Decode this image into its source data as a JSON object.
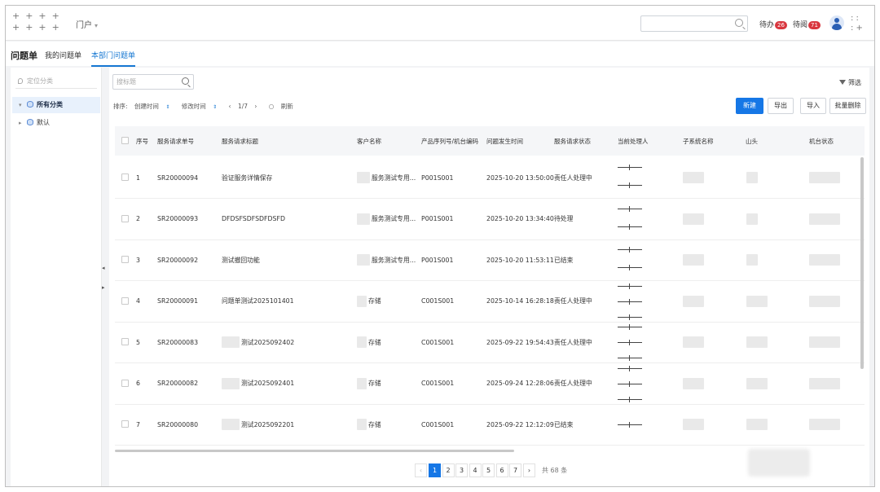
{
  "header": {
    "portal_label": "门户",
    "todo_label": "待办",
    "todo_count": "26",
    "waiting_label": "待阅",
    "waiting_count": "71"
  },
  "page": {
    "title": "问题单",
    "tabs": [
      {
        "label": "我的问题单",
        "active": false
      },
      {
        "label": "本部门问题单",
        "active": true
      }
    ]
  },
  "sidebar": {
    "locate_placeholder": "定位分类",
    "items": [
      {
        "label": "所有分类",
        "selected": true
      },
      {
        "label": "默认",
        "selected": false
      }
    ]
  },
  "toolbar": {
    "search_placeholder": "搜标题",
    "filter_label": "筛选",
    "sort_label": "排序:",
    "sort_created": "创建时间",
    "sort_modified": "修改时间",
    "page_indicator": "1/7",
    "refresh_label": "刷新",
    "buttons": [
      "新建",
      "导出",
      "导入",
      "批量删除"
    ]
  },
  "table": {
    "columns": [
      "序号",
      "服务请求单号",
      "服务请求标题",
      "客户名称",
      "产品序列号/机台编码",
      "问题发生时间",
      "服务请求状态",
      "当前处理人",
      "子系统名称",
      "山头",
      "机台状态"
    ],
    "rows": [
      {
        "no": "1",
        "id": "SR20000094",
        "title": "验证服务详情保存",
        "customer": "服务测试专用...",
        "serial": "P001S001",
        "time": "2025-10-20 13:50:00",
        "status": "责任人处理中"
      },
      {
        "no": "2",
        "id": "SR20000093",
        "title": "DFDSFSDFSDFDSFD",
        "customer": "服务测试专用...",
        "serial": "P001S001",
        "time": "2025-10-20 13:34:40",
        "status": "待处理"
      },
      {
        "no": "3",
        "id": "SR20000092",
        "title": "测试撤回功能",
        "customer": "服务测试专用...",
        "serial": "P001S001",
        "time": "2025-10-20 11:53:11",
        "status": "已结束"
      },
      {
        "no": "4",
        "id": "SR20000091",
        "title": "问题单测试2025101401",
        "customer": "存储",
        "serial": "C001S001",
        "time": "2025-10-14 16:28:18",
        "status": "责任人处理中"
      },
      {
        "no": "5",
        "id": "SR20000083",
        "title": "测试2025092402",
        "customer": "存储",
        "serial": "C001S001",
        "time": "2025-09-22 19:54:43",
        "status": "责任人处理中"
      },
      {
        "no": "6",
        "id": "SR20000082",
        "title": "测试2025092401",
        "customer": "存储",
        "serial": "C001S001",
        "time": "2025-09-24 12:28:06",
        "status": "责任人处理中"
      },
      {
        "no": "7",
        "id": "SR20000080",
        "title": "测试2025092201",
        "customer": "存储",
        "serial": "C001S001",
        "time": "2025-09-22 12:12:09",
        "status": "已结束"
      }
    ]
  },
  "pagination": {
    "prev": "‹",
    "pages": [
      "1",
      "2",
      "3",
      "4",
      "5",
      "6",
      "7"
    ],
    "current": "1",
    "next": "›",
    "total": "共 68 条"
  }
}
